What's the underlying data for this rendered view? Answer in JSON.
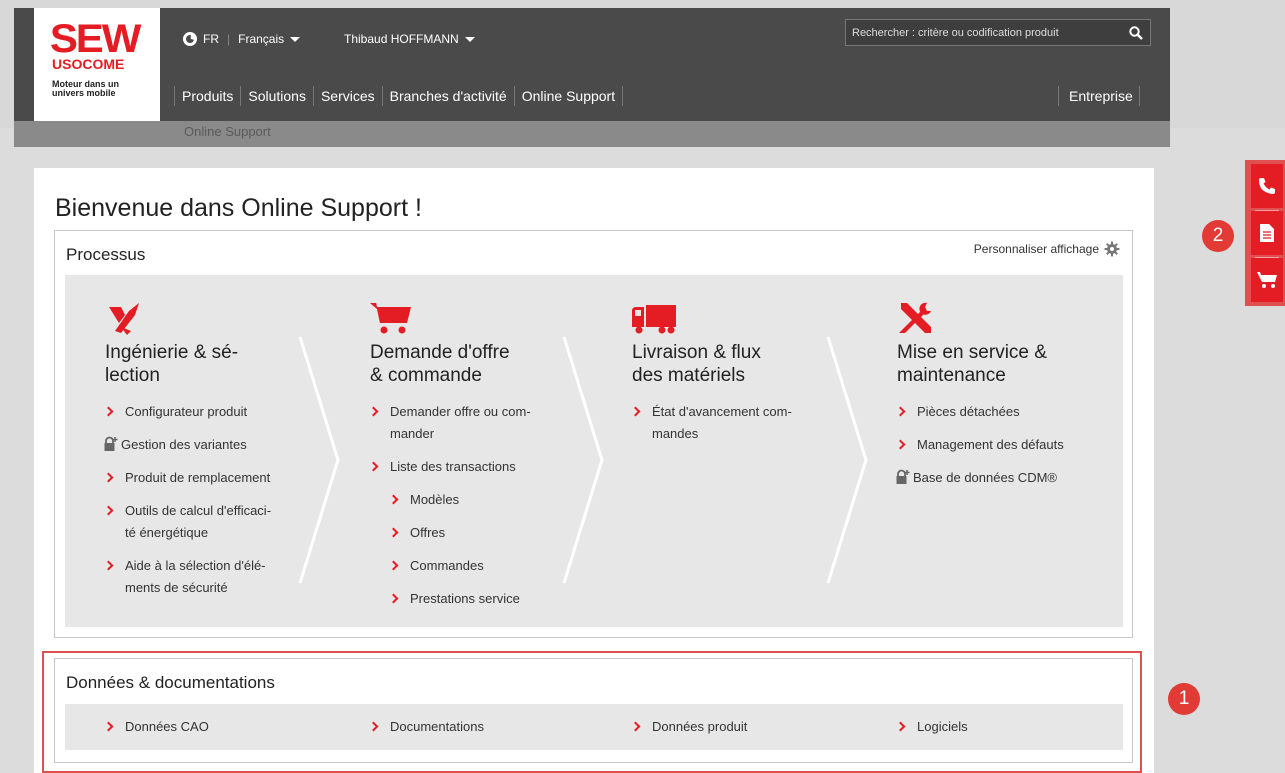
{
  "header": {
    "logo": {
      "brand": "SEW",
      "sub": "USOCOME",
      "tagline_1": "Moteur dans un",
      "tagline_2": "univers mobile"
    },
    "lang_code": "FR",
    "lang_name": "Français",
    "user_name": "Thibaud HOFFMANN",
    "search_placeholder": "Rechercher : critère ou codification produit",
    "nav": [
      "Produits",
      "Solutions",
      "Services",
      "Branches d'activité",
      "Online Support"
    ],
    "nav_right": "Entreprise",
    "breadcrumb": "Online Support"
  },
  "main": {
    "title": "Bienvenue dans Online Support !",
    "processus": {
      "title": "Processus",
      "personalize": "Personnaliser affichage",
      "columns": [
        {
          "icon": "engineering-icon",
          "title_1": "Ingénierie & sé-",
          "title_2": "lection",
          "links": [
            {
              "l1": "Configurateur produit",
              "l2": ""
            },
            {
              "l1": "Gestion des variantes",
              "l2": ""
            },
            {
              "l1": "Produit de remplacement",
              "l2": ""
            },
            {
              "l1": "Outils de calcul d'efficaci-",
              "l2": "té énergétique"
            },
            {
              "l1": "Aide à la sélection d'élé-",
              "l2": "ments de sécurité"
            }
          ]
        },
        {
          "icon": "cart-icon",
          "title_1": "Demande d'offre",
          "title_2": "& commande",
          "links": [
            {
              "l1": "Demander offre ou com-",
              "l2": "mander"
            },
            {
              "l1": "Liste des transactions",
              "l2": ""
            },
            {
              "l1": "Modèles",
              "l2": ""
            },
            {
              "l1": "Offres",
              "l2": ""
            },
            {
              "l1": "Commandes",
              "l2": ""
            },
            {
              "l1": "Prestations service",
              "l2": ""
            }
          ]
        },
        {
          "icon": "truck-icon",
          "title_1": "Livraison & flux",
          "title_2": "des matériels",
          "links": [
            {
              "l1": "État d'avancement com-",
              "l2": "mandes"
            }
          ]
        },
        {
          "icon": "tools-icon",
          "title_1": "Mise en service &",
          "title_2": "maintenance",
          "links": [
            {
              "l1": "Pièces détachées",
              "l2": ""
            },
            {
              "l1": "Management des défauts",
              "l2": ""
            },
            {
              "l1": "Base de données CDM®",
              "l2": ""
            }
          ]
        }
      ]
    },
    "docs": {
      "title": "Données & documentations",
      "links": [
        "Données CAO",
        "Documentations",
        "Données produit",
        "Logiciels"
      ]
    }
  },
  "annotations": {
    "badge_1": "1",
    "badge_2": "2"
  },
  "colors": {
    "accent": "#e41c23",
    "header": "#4a4a4a",
    "annotation": "#e05050"
  }
}
